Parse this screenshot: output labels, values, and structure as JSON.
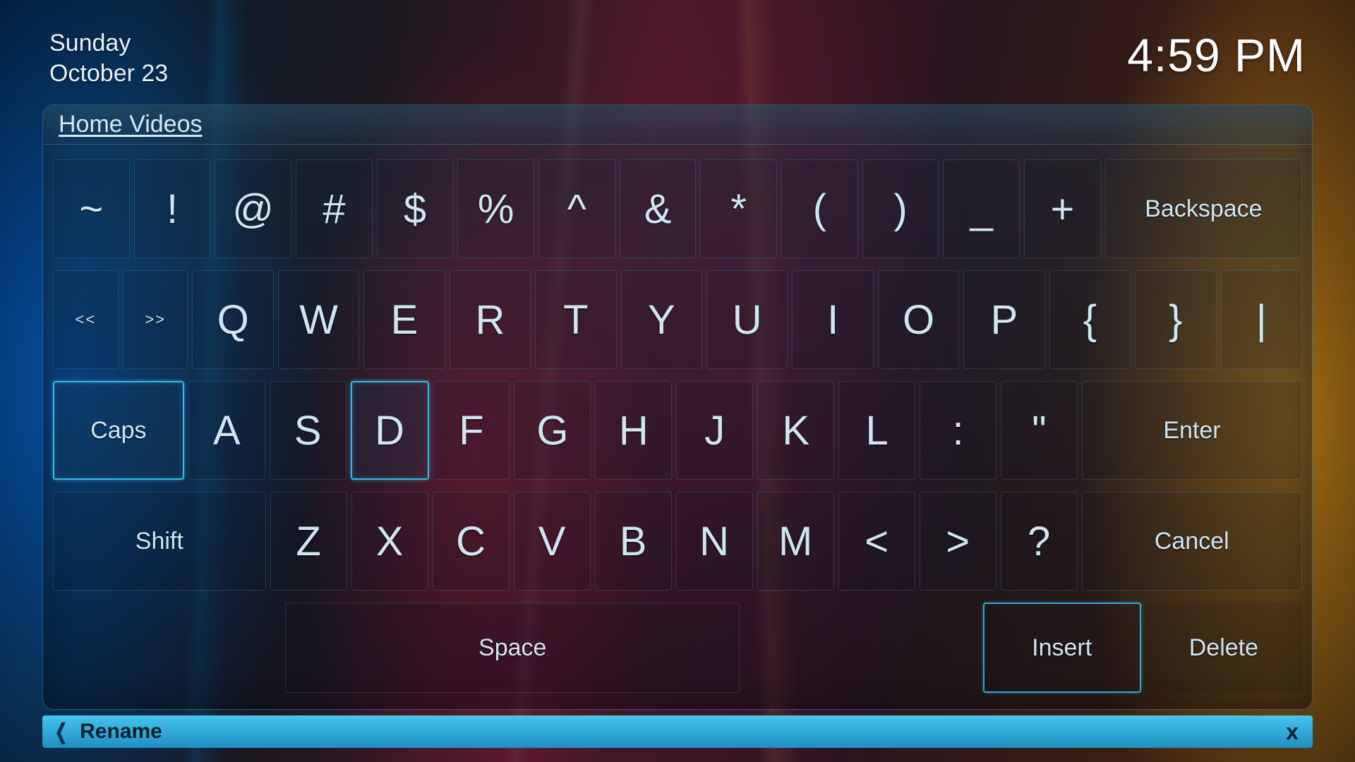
{
  "header": {
    "day": "Sunday",
    "date": "October 23",
    "time": "4:59 PM"
  },
  "panel_title": "Home Videos",
  "rows": {
    "r1": [
      "~",
      "!",
      "@",
      "#",
      "$",
      "%",
      "^",
      "&",
      "*",
      "(",
      ")",
      "_",
      "+"
    ],
    "r1_backspace": "Backspace",
    "r2_tab_left": "<<",
    "r2_tab_right": ">>",
    "r2": [
      "Q",
      "W",
      "E",
      "R",
      "T",
      "Y",
      "U",
      "I",
      "O",
      "P",
      "{",
      "}",
      "|"
    ],
    "r3_caps": "Caps",
    "r3": [
      "A",
      "S",
      "D",
      "F",
      "G",
      "H",
      "J",
      "K",
      "L",
      ":",
      "\""
    ],
    "r3_enter": "Enter",
    "r4_shift": "Shift",
    "r4": [
      "Z",
      "X",
      "C",
      "V",
      "B",
      "N",
      "M",
      "<",
      ">",
      "?"
    ],
    "r4_cancel": "Cancel",
    "r5_space": "Space",
    "r5_insert": "Insert",
    "r5_delete": "Delete"
  },
  "footer": {
    "label": "Rename",
    "close": "x"
  }
}
